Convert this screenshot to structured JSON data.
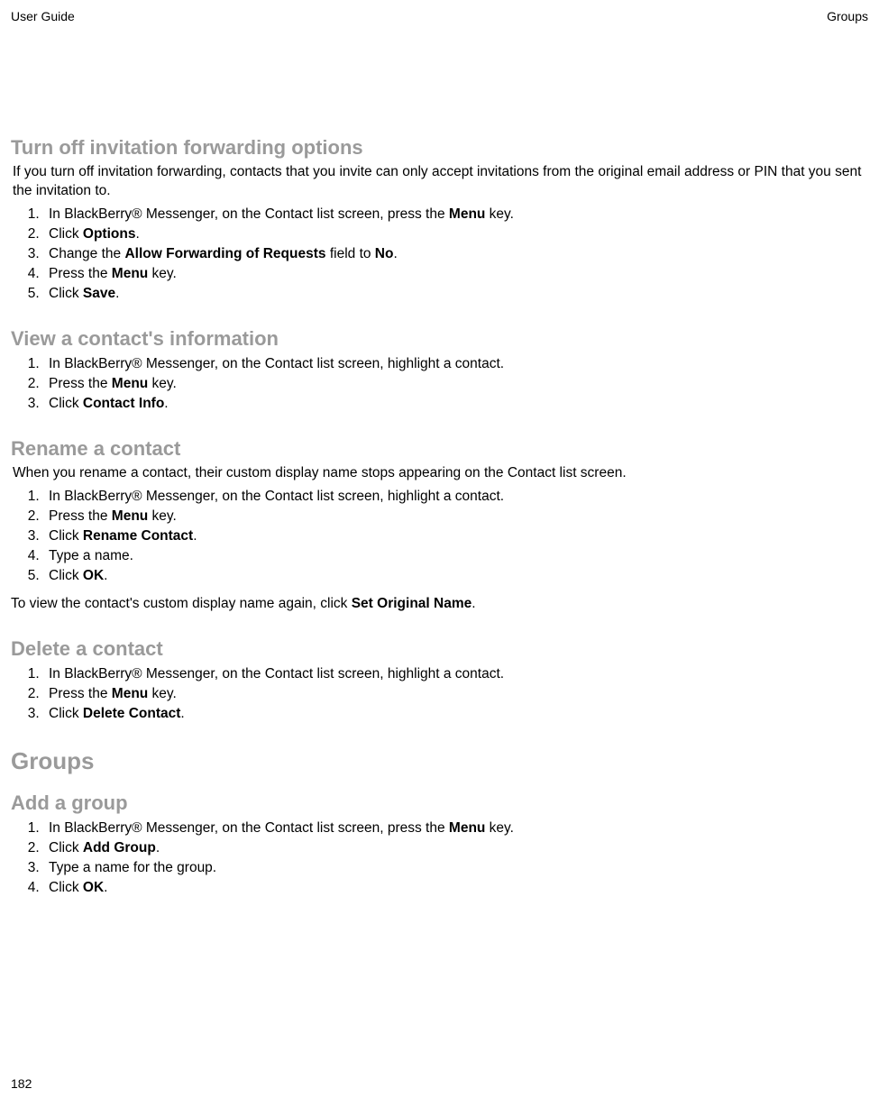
{
  "header": {
    "left": "User Guide",
    "right": "Groups"
  },
  "page_number": "182",
  "sections": [
    {
      "title": "Turn off invitation forwarding options",
      "intro_html": "If you turn off invitation forwarding, contacts that you invite can only accept invitations from the original email address or PIN that you sent the invitation to.",
      "steps_html": [
        "In BlackBerry® Messenger, on the Contact list screen, press the <b>Menu</b> key.",
        "Click <b>Options</b>.",
        "Change the <b>Allow Forwarding of Requests</b> field to <b>No</b>.",
        "Press the <b>Menu</b> key.",
        "Click <b>Save</b>."
      ]
    },
    {
      "title": "View a contact's information",
      "steps_html": [
        "In BlackBerry® Messenger, on the Contact list screen, highlight a contact.",
        "Press the <b>Menu</b> key.",
        "Click <b>Contact Info</b>."
      ]
    },
    {
      "title": "Rename a contact",
      "intro_html": "When you rename a contact, their custom display name stops appearing on the Contact list screen.",
      "steps_html": [
        "In BlackBerry® Messenger, on the Contact list screen, highlight a contact.",
        "Press the <b>Menu</b> key.",
        "Click <b>Rename Contact</b>.",
        "Type a name.",
        "Click <b>OK</b>."
      ],
      "post_html": "To view the contact's custom display name again, click <b>Set Original Name</b>."
    },
    {
      "title": "Delete a contact",
      "steps_html": [
        "In BlackBerry® Messenger, on the Contact list screen, highlight a contact.",
        "Press the <b>Menu</b> key.",
        "Click <b>Delete Contact</b>."
      ]
    }
  ],
  "groups": {
    "title": "Groups",
    "sections": [
      {
        "title": "Add a group",
        "steps_html": [
          "In BlackBerry® Messenger, on the Contact list screen, press the <b>Menu</b> key.",
          "Click <b>Add Group</b>.",
          "Type a name for the group.",
          "Click <b>OK</b>."
        ]
      }
    ]
  }
}
